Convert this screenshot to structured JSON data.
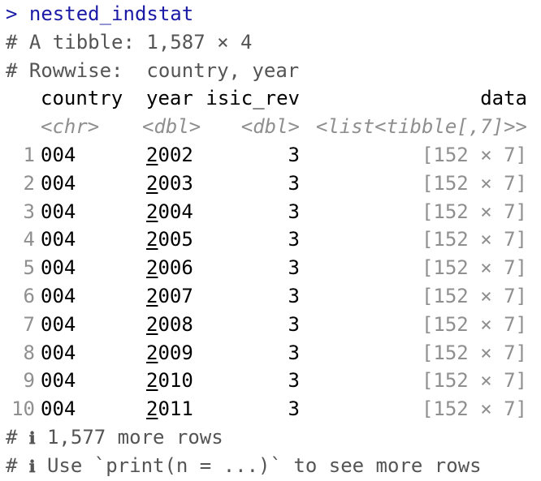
{
  "console": {
    "prompt_symbol": ">",
    "command": "nested_indstat",
    "header_line_1": "# A tibble: 1,587 × 4",
    "header_line_2": "# Rowwise:  country, year"
  },
  "columns": [
    {
      "name": "country",
      "type": "<chr>"
    },
    {
      "name": "year",
      "type": "<dbl>"
    },
    {
      "name": "isic_rev",
      "type": "<dbl>"
    },
    {
      "name": "data",
      "type": "<list<tibble[,7]>>"
    }
  ],
  "rows": [
    {
      "n": "1",
      "country": "004",
      "year_lead": "2",
      "year_rest": "002",
      "isic_rev": "3",
      "data": "[152 × 7]"
    },
    {
      "n": "2",
      "country": "004",
      "year_lead": "2",
      "year_rest": "003",
      "isic_rev": "3",
      "data": "[152 × 7]"
    },
    {
      "n": "3",
      "country": "004",
      "year_lead": "2",
      "year_rest": "004",
      "isic_rev": "3",
      "data": "[152 × 7]"
    },
    {
      "n": "4",
      "country": "004",
      "year_lead": "2",
      "year_rest": "005",
      "isic_rev": "3",
      "data": "[152 × 7]"
    },
    {
      "n": "5",
      "country": "004",
      "year_lead": "2",
      "year_rest": "006",
      "isic_rev": "3",
      "data": "[152 × 7]"
    },
    {
      "n": "6",
      "country": "004",
      "year_lead": "2",
      "year_rest": "007",
      "isic_rev": "3",
      "data": "[152 × 7]"
    },
    {
      "n": "7",
      "country": "004",
      "year_lead": "2",
      "year_rest": "008",
      "isic_rev": "3",
      "data": "[152 × 7]"
    },
    {
      "n": "8",
      "country": "004",
      "year_lead": "2",
      "year_rest": "009",
      "isic_rev": "3",
      "data": "[152 × 7]"
    },
    {
      "n": "9",
      "country": "004",
      "year_lead": "2",
      "year_rest": "010",
      "isic_rev": "3",
      "data": "[152 × 7]"
    },
    {
      "n": "10",
      "country": "004",
      "year_lead": "2",
      "year_rest": "011",
      "isic_rev": "3",
      "data": "[152 × 7]"
    }
  ],
  "footer": {
    "comment_prefix": "#",
    "info_symbol": "ℹ",
    "more_rows": "1,577 more rows",
    "hint": "Use `print(n = ...)` to see more rows"
  },
  "colors": {
    "prompt": "#1a1aa6",
    "muted": "#8f8f8f",
    "comment": "#555555"
  }
}
